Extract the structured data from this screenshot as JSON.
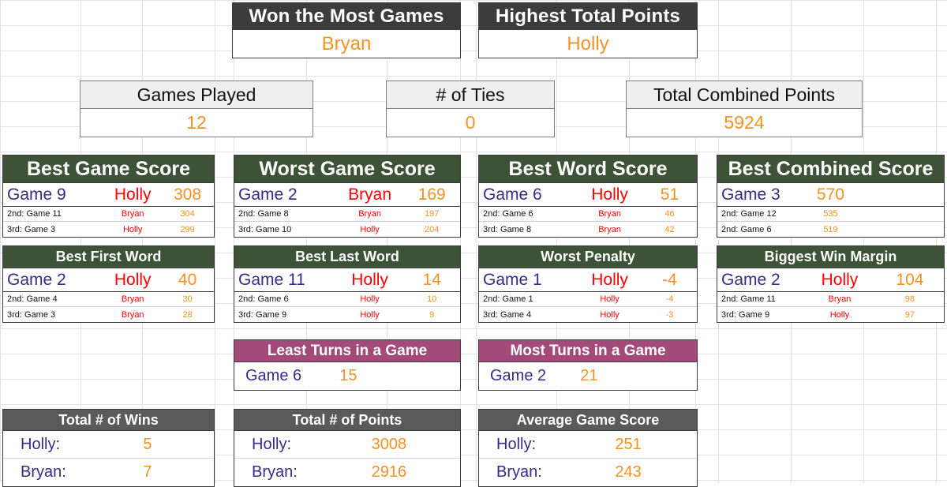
{
  "top_cards": [
    {
      "title": "Won the Most Games",
      "value": "Bryan"
    },
    {
      "title": "Highest Total Points",
      "value": "Holly"
    }
  ],
  "summary_cards": [
    {
      "title": "Games Played",
      "value": "12"
    },
    {
      "title": "# of Ties",
      "value": "0"
    },
    {
      "title": "Total Combined Points",
      "value": "5924"
    }
  ],
  "stat_panels": [
    {
      "title": "Best Game Score",
      "first": {
        "game": "Game 9",
        "name": "Holly",
        "value": "308"
      },
      "second": {
        "game": "2nd: Game 11",
        "name": "Bryan",
        "value": "304"
      },
      "third": {
        "game": "3rd: Game 3",
        "name": "Holly",
        "value": "299"
      }
    },
    {
      "title": "Worst Game Score",
      "first": {
        "game": "Game 2",
        "name": "Bryan",
        "value": "169"
      },
      "second": {
        "game": "2nd: Game 8",
        "name": "Bryan",
        "value": "197"
      },
      "third": {
        "game": "3rd: Game 10",
        "name": "Holly",
        "value": "204"
      }
    },
    {
      "title": "Best Word Score",
      "first": {
        "game": "Game 6",
        "name": "Holly",
        "value": "51"
      },
      "second": {
        "game": "2nd: Game 6",
        "name": "Bryan",
        "value": "46"
      },
      "third": {
        "game": "3rd: Game 8",
        "name": "Bryan",
        "value": "42"
      }
    },
    {
      "title": "Best Combined Score",
      "first": {
        "game": "Game 3",
        "name": "",
        "value": "570"
      },
      "second": {
        "game": "2nd: Game 12",
        "name": "",
        "value": "535"
      },
      "third": {
        "game": "2nd: Game 6",
        "name": "",
        "value": "519"
      }
    },
    {
      "title": "Best First Word",
      "first": {
        "game": "Game 2",
        "name": "Holly",
        "value": "40"
      },
      "second": {
        "game": "2nd: Game 4",
        "name": "Bryan",
        "value": "30"
      },
      "third": {
        "game": "3rd: Game 3",
        "name": "Bryan",
        "value": "28"
      }
    },
    {
      "title": "Best Last Word",
      "first": {
        "game": "Game 11",
        "name": "Holly",
        "value": "14"
      },
      "second": {
        "game": "2nd: Game 6",
        "name": "Holly",
        "value": "10"
      },
      "third": {
        "game": "3rd: Game 9",
        "name": "Holly",
        "value": "9"
      }
    },
    {
      "title": "Worst Penalty",
      "first": {
        "game": "Game 1",
        "name": "Holly",
        "value": "-4"
      },
      "second": {
        "game": "2nd: Game 1",
        "name": "Holly",
        "value": "-4"
      },
      "third": {
        "game": "3rd: Game 4",
        "name": "Holly",
        "value": "-3"
      }
    },
    {
      "title": "Biggest Win Margin",
      "first": {
        "game": "Game 2",
        "name": "Holly",
        "value": "104"
      },
      "second": {
        "game": "2nd: Game 11",
        "name": "Bryan",
        "value": "98"
      },
      "third": {
        "game": "3rd: Game 9",
        "name": "Holly",
        "value": "97"
      }
    }
  ],
  "turn_panels": [
    {
      "title": "Least Turns in a Game",
      "game": "Game 6",
      "value": "15"
    },
    {
      "title": "Most Turns in a Game",
      "game": "Game 2",
      "value": "21"
    }
  ],
  "total_panels": [
    {
      "title": "Total # of Wins",
      "rows": [
        {
          "label": "Holly:",
          "value": "5"
        },
        {
          "label": "Bryan:",
          "value": "7"
        }
      ]
    },
    {
      "title": "Total # of Points",
      "rows": [
        {
          "label": "Holly:",
          "value": "3008"
        },
        {
          "label": "Bryan:",
          "value": "2916"
        }
      ]
    },
    {
      "title": "Average Game Score",
      "rows": [
        {
          "label": "Holly:",
          "value": "251"
        },
        {
          "label": "Bryan:",
          "value": "243"
        }
      ]
    }
  ],
  "colors": {
    "green": "#3d5236",
    "mauve": "#a44a7b",
    "dark": "#3c3c3c",
    "gray": "#5a5a5a",
    "orange": "#f59122",
    "red": "#ff0000",
    "indigo": "#352c87"
  }
}
